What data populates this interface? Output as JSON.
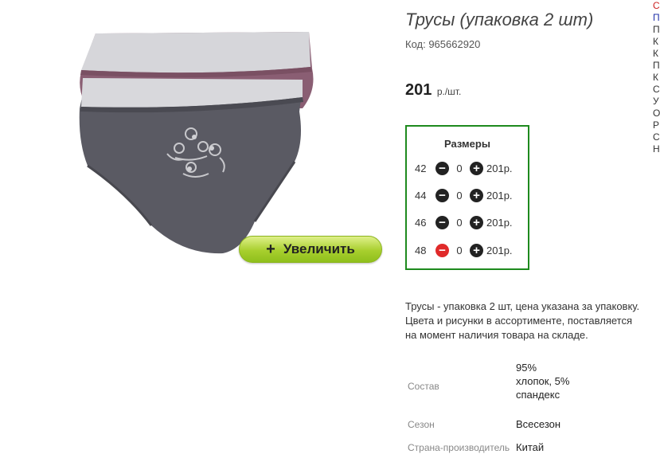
{
  "product": {
    "title": "Трусы (упаковка 2 шт)",
    "code_label": "Код: 965662920",
    "price": "201",
    "price_unit": "р./шт.",
    "zoom_button": {
      "icon": "plus-icon",
      "plus": "+",
      "label": "Увеличить"
    }
  },
  "sizes": {
    "title": "Размеры",
    "rows": [
      {
        "size": "42",
        "qty": "0",
        "price": "201р."
      },
      {
        "size": "44",
        "qty": "0",
        "price": "201р."
      },
      {
        "size": "46",
        "qty": "0",
        "price": "201р."
      },
      {
        "size": "48",
        "qty": "0",
        "price": "201р."
      }
    ]
  },
  "description": {
    "line1": "Трусы - упаковка 2 шт, цена указана за упаковку.",
    "line2": "Цвета и рисунки в ассортименте, поставляется",
    "line3": "на момент наличия товара на складе."
  },
  "specs": {
    "composition_label": "Состав",
    "composition_value": "95% хлопок, 5% спандекс",
    "season_label": "Сезон",
    "season_value": "Всесезон",
    "country_label": "Страна-производитель",
    "country_value": "Китай"
  },
  "side_nav": {
    "items": [
      "С",
      "П",
      "П",
      "К",
      "К",
      "П",
      "К",
      "С",
      "У",
      "О",
      "Р",
      "С",
      "Н"
    ],
    "colors": {
      "first": "#cc2222",
      "second": "#2233aa"
    }
  },
  "colors": {
    "sizes_border": "#1e8a1e",
    "button_green": "#a8cf2e",
    "minus_active": "#e02a2a"
  }
}
